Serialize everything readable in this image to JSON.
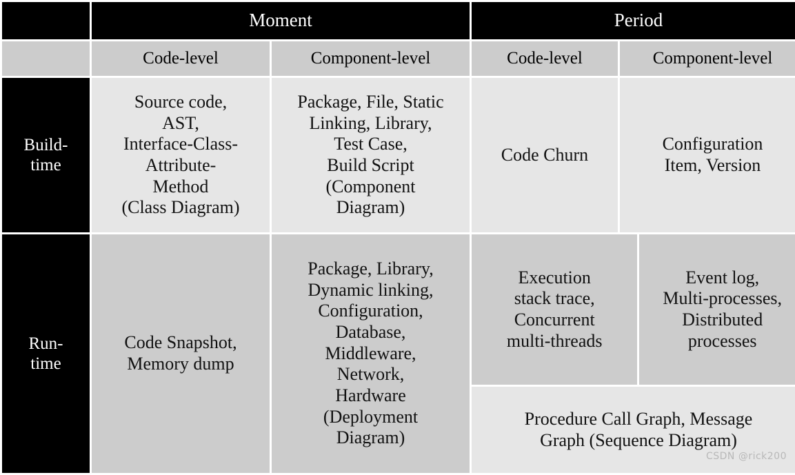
{
  "table": {
    "corner_label": "",
    "group_headers": [
      {
        "label": "Moment",
        "span": 2
      },
      {
        "label": "Period",
        "span": 2
      }
    ],
    "sub_headers": [
      "Code-level",
      "Component-level",
      "Code-level",
      "Component-level"
    ],
    "rows": [
      {
        "label": "Build-\ntime",
        "moment_code": "Source code,\nAST,\nInterface-Class-\nAttribute-\nMethod\n(Class Diagram)",
        "moment_component": "Package, File, Static\nLinking, Library,\nTest Case,\nBuild Script\n(Component\nDiagram)",
        "period_code": "Code Churn",
        "period_component": "Configuration\nItem, Version"
      },
      {
        "label": "Run-\ntime",
        "moment_code": "Code Snapshot,\nMemory dump",
        "moment_component": "Package, Library,\nDynamic  linking,\nConfiguration,\nDatabase,\nMiddleware,\nNetwork,\nHardware\n(Deployment\nDiagram)",
        "period_code": "Execution\nstack trace,\nConcurrent\nmulti-threads",
        "period_component": "Event log,\nMulti-processes,\nDistributed\nprocesses",
        "period_merged_bottom": "Procedure Call Graph, Message\nGraph (Sequence Diagram)"
      }
    ]
  },
  "watermark": "CSDN @rick200",
  "colors": {
    "header_black": "#000000",
    "header_gray": "#cccccc",
    "cell_light": "#e6e6e6",
    "cell_mid": "#cccccc",
    "page_background": "#ffffff",
    "watermark_text": "#b8b8b8"
  }
}
